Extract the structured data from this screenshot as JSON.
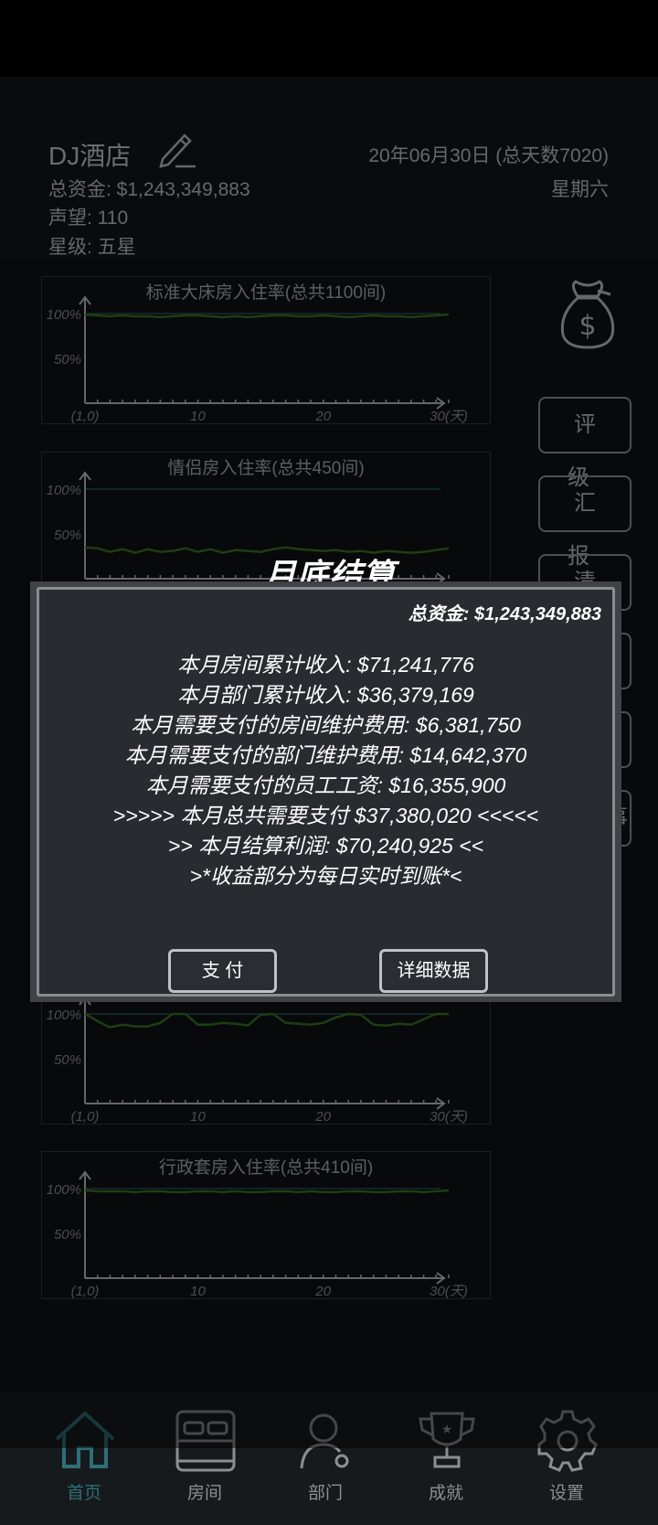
{
  "header": {
    "hotel_name": "DJ酒店",
    "funds": "总资金: $1,243,349,883",
    "reputation": "声望: 110",
    "star": "星级: 五星",
    "date": "20年06月30日 (总天数7020)",
    "weekday": "星期六"
  },
  "side_buttons": [
    "评 级",
    "汇 报",
    "清 扰",
    "",
    "",
    "事"
  ],
  "chart_data": [
    {
      "type": "line",
      "title": "标准大床房入住率(总共1100间)",
      "y_ticks": [
        "100%",
        "50%"
      ],
      "x_ticks": [
        "(1,0)",
        "10",
        "20",
        "30(天)"
      ],
      "xlim": [
        1,
        30
      ],
      "ylim": [
        0,
        100
      ],
      "series": [
        {
          "values": [
            99,
            98,
            97,
            98,
            97,
            97,
            96,
            97,
            98,
            98,
            97,
            96,
            97,
            96,
            97,
            98,
            98,
            97,
            97,
            98,
            97,
            96,
            97,
            98,
            97,
            97,
            96,
            97,
            98,
            99
          ]
        }
      ]
    },
    {
      "type": "line",
      "title": "情侣房入住率(总共450间)",
      "y_ticks": [
        "100%",
        "50%"
      ],
      "x_ticks": [
        "(1,0)",
        "10",
        "20",
        "30(天)"
      ],
      "xlim": [
        1,
        30
      ],
      "ylim": [
        0,
        100
      ],
      "series": [
        {
          "values": [
            35,
            34,
            30,
            33,
            29,
            33,
            30,
            31,
            34,
            30,
            33,
            29,
            32,
            31,
            30,
            33,
            35,
            33,
            32,
            31,
            32,
            30,
            31,
            29,
            31,
            30,
            29,
            30,
            32,
            34
          ]
        }
      ]
    },
    {
      "type": "line",
      "title": "",
      "y_ticks": [
        "100%",
        "50%"
      ],
      "x_ticks": [
        "(1,0)",
        "10",
        "20",
        "30(天)"
      ],
      "xlim": [
        1,
        30
      ],
      "ylim": [
        0,
        100
      ],
      "series": [
        {
          "values": [
            100,
            92,
            85,
            88,
            86,
            86,
            90,
            100,
            100,
            88,
            88,
            90,
            89,
            87,
            99,
            100,
            90,
            89,
            88,
            90,
            96,
            100,
            99,
            88,
            87,
            89,
            88,
            94,
            100,
            100
          ]
        }
      ]
    },
    {
      "type": "line",
      "title": "行政套房入住率(总共410间)",
      "y_ticks": [
        "100%",
        "50%"
      ],
      "x_ticks": [
        "(1,0)",
        "10",
        "20",
        "30(天)"
      ],
      "xlim": [
        1,
        30
      ],
      "ylim": [
        0,
        100
      ],
      "series": [
        {
          "values": [
            98,
            97,
            97,
            97,
            96,
            97,
            97,
            96,
            96,
            97,
            97,
            96,
            97,
            96,
            96,
            97,
            97,
            96,
            97,
            96,
            96,
            97,
            97,
            96,
            96,
            97,
            97,
            96,
            97,
            98
          ]
        }
      ]
    }
  ],
  "dialog": {
    "title": "月底结算",
    "funds": "总资金: $1,243,349,883",
    "lines": [
      "本月房间累计收入: $71,241,776",
      "本月部门累计收入: $36,379,169",
      "本月需要支付的房间维护费用: $6,381,750",
      "本月需要支付的部门维护费用: $14,642,370",
      "本月需要支付的员工工资: $16,355,900",
      ">>>>> 本月总共需要支付 $37,380,020 <<<<<",
      ">> 本月结算利润: $70,240,925 <<",
      ">*收益部分为每日实时到账*<"
    ],
    "pay_label": "支 付",
    "detail_label": "详细数据"
  },
  "nav": {
    "items": [
      {
        "label": "首页",
        "icon": "home-icon"
      },
      {
        "label": "房间",
        "icon": "bed-icon"
      },
      {
        "label": "部门",
        "icon": "staff-gear-icon"
      },
      {
        "label": "成就",
        "icon": "trophy-icon"
      },
      {
        "label": "设置",
        "icon": "settings-gear-icon"
      }
    ],
    "active_color": "#2e6f78"
  }
}
